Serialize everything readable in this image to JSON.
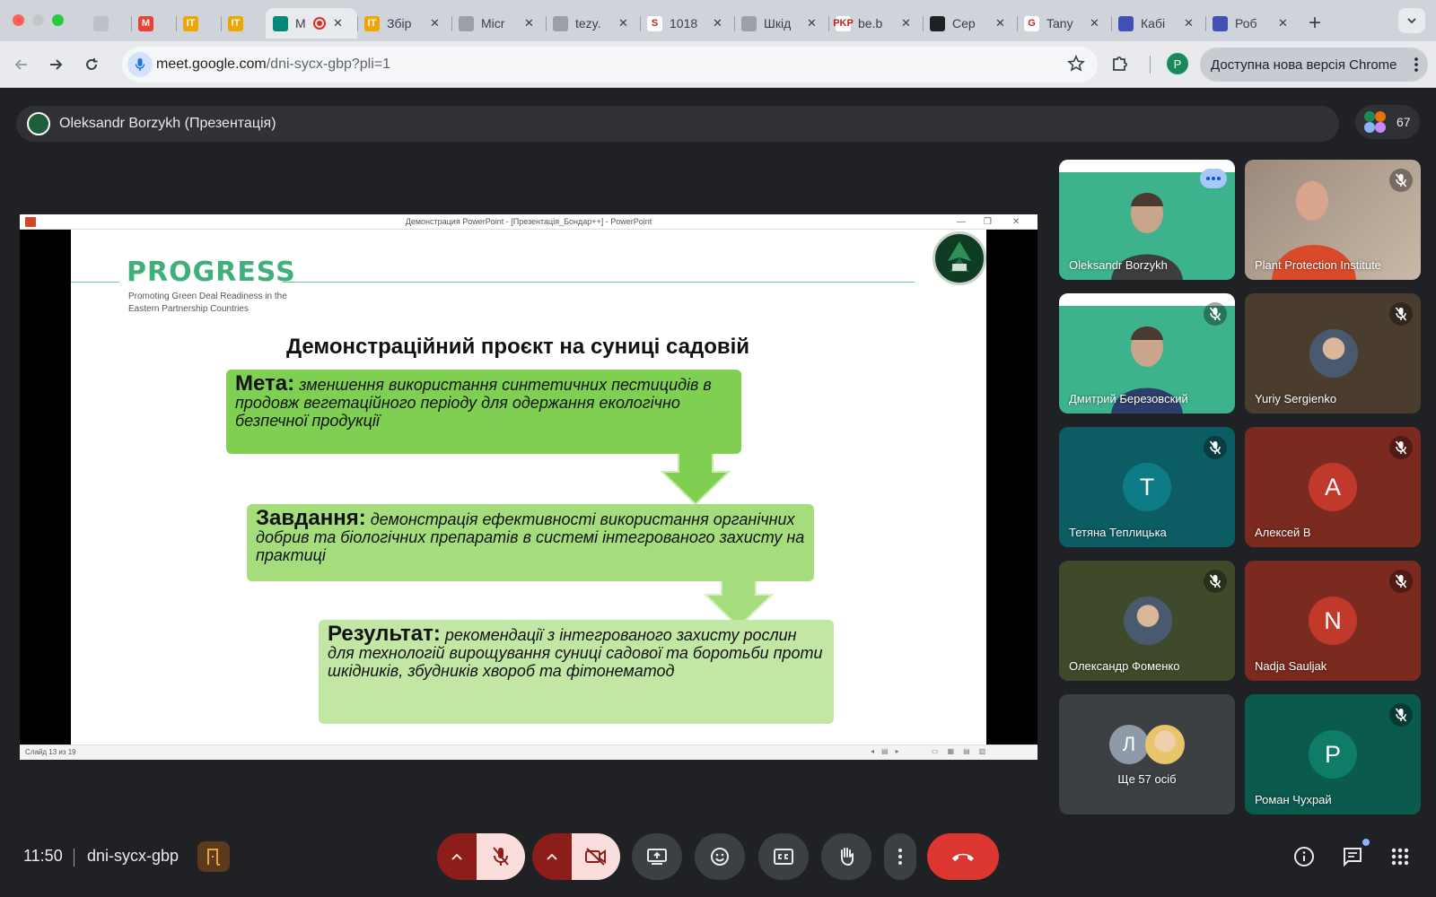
{
  "browser": {
    "tabs": [
      {
        "title": "",
        "favicon_text": "",
        "favicon_color": "#bdc1c6"
      },
      {
        "title": "",
        "favicon_text": "M",
        "favicon_color": "#ea4335"
      },
      {
        "title": "",
        "favicon_text": "IT",
        "favicon_color": "#f0a500"
      },
      {
        "title": "",
        "favicon_text": "IT",
        "favicon_color": "#f0a500"
      },
      {
        "title": "M",
        "favicon_text": "",
        "favicon_color": "#00897b",
        "active": true
      },
      {
        "title": "Збір",
        "favicon_text": "IT",
        "favicon_color": "#f0a500"
      },
      {
        "title": "Micr",
        "favicon_text": "",
        "favicon_color": "#9aa0a6"
      },
      {
        "title": "tezy.",
        "favicon_text": "",
        "favicon_color": "#9aa0a6"
      },
      {
        "title": "1018",
        "favicon_text": "S",
        "favicon_color": "#ffffff"
      },
      {
        "title": "Шкід",
        "favicon_text": "",
        "favicon_color": "#9aa0a6"
      },
      {
        "title": "be.b",
        "favicon_text": "PKP",
        "favicon_color": "#ffffff"
      },
      {
        "title": "Сер",
        "favicon_text": "",
        "favicon_color": "#202124"
      },
      {
        "title": "Tany",
        "favicon_text": "G",
        "favicon_color": "#ffffff"
      },
      {
        "title": "Кабі",
        "favicon_text": "",
        "favicon_color": "#3f51b5"
      },
      {
        "title": "Роб",
        "favicon_text": "",
        "favicon_color": "#3f51b5"
      }
    ],
    "url_host": "meet.google.com",
    "url_path": "/dni-sycx-gbp?pli=1",
    "profile_initial": "P",
    "update_label": "Доступна нова версія Chrome"
  },
  "meet": {
    "presenter_label": "Oleksandr Borzykh (Презентація)",
    "participant_count": "67",
    "time": "11:50",
    "meeting_code": "dni-sycx-gbp"
  },
  "presentation": {
    "window_title": "Демонстрация PowerPoint - [Презентація_Бондар++] - PowerPoint",
    "status_text": "Слайд 13 из 19",
    "logo": "PROGRESS",
    "logo_sub": "Promoting Green Deal Readiness in the Eastern Partnership Countries",
    "heading": "Демонстраційний проєкт на суниці садовій",
    "boxes": [
      {
        "label": "Мета:",
        "text": "зменшення використання синтетичних пестицидів в продовж вегетаційного періоду для одержання екологічно безпечної продукції"
      },
      {
        "label": "Завдання:",
        "text": "демонстрація ефективності використання органічних добрив та біологічних препаратів в системі інтегрованого захисту на практиці"
      },
      {
        "label": "Результат:",
        "text": "рекомендації з інтегрованого захисту рослин для технологій вирощування суниці садової та боротьби проти шкідників, збудників хвороб та фітонематод"
      }
    ]
  },
  "participants": [
    {
      "name": "Oleksandr Borzykh",
      "type": "video-slide",
      "muted": false
    },
    {
      "name": "Plant Protection Institute",
      "type": "video",
      "muted": true
    },
    {
      "name": "Дмитрий Березовский",
      "type": "video-slide",
      "muted": true
    },
    {
      "name": "Yuriy Sergienko",
      "type": "photo",
      "muted": true,
      "bg": "#4a3d2e"
    },
    {
      "name": "Тетяна Теплицька",
      "type": "initial",
      "initial": "T",
      "muted": true,
      "bg": "#0b5c63",
      "avatar_color": "#0e7c86"
    },
    {
      "name": "Алексей В",
      "type": "initial",
      "initial": "A",
      "muted": true,
      "bg": "#7a2a1f",
      "avatar_color": "#c0392b"
    },
    {
      "name": "Олександр Фоменко",
      "type": "photo",
      "muted": true,
      "bg": "#3e4a2a"
    },
    {
      "name": "Nadja Sauljak",
      "type": "initial",
      "initial": "N",
      "muted": true,
      "bg": "#7a2a1f",
      "avatar_color": "#c0392b"
    },
    {
      "name": "Ще 57 осіб",
      "type": "more",
      "initial": "Л",
      "muted": false,
      "bg": "#3c4043"
    },
    {
      "name": "Роман Чухрай",
      "type": "initial",
      "initial": "P",
      "muted": true,
      "bg": "#0b5a4e",
      "avatar_color": "#0e7c66"
    }
  ],
  "colors": {
    "end_call": "#dc362e",
    "mic_off_bg": "#f9dedc",
    "accent": "#3fb07a"
  }
}
